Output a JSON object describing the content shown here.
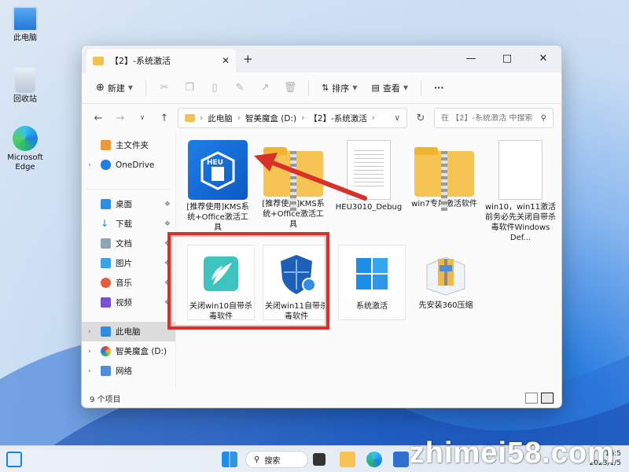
{
  "desktop": {
    "icons": [
      {
        "label": "此电脑"
      },
      {
        "label": "回收站"
      },
      {
        "label": "Microsoft Edge"
      }
    ]
  },
  "window": {
    "tab_title": "【2】-系统激活",
    "tab_close": "✕",
    "new_tab": "+",
    "toolbar": {
      "new_label": "新建",
      "sort_label": "排序",
      "view_label": "查看",
      "more_label": "···"
    },
    "address": {
      "crumbs": [
        "此电脑",
        "智美魔盒 (D:)",
        "【2】-系统激活"
      ],
      "search_placeholder": "在 【2】-系统激活 中搜索"
    },
    "sidebar": {
      "items": [
        {
          "label": "主文件夹"
        },
        {
          "label": "OneDrive"
        },
        {
          "label": "桌面"
        },
        {
          "label": "下载"
        },
        {
          "label": "文档"
        },
        {
          "label": "图片"
        },
        {
          "label": "音乐"
        },
        {
          "label": "视频"
        },
        {
          "label": "此电脑"
        },
        {
          "label": "智美魔盒 (D:)"
        },
        {
          "label": "网络"
        }
      ]
    },
    "files": [
      {
        "name": "[推荐使用]KMS系统+Office激活工具"
      },
      {
        "name": "[推荐使用]KMS系统+Office激活工具"
      },
      {
        "name": "HEU3010_Debug"
      },
      {
        "name": "win7专用激活软件"
      },
      {
        "name": "win10，win11激活前务必先关闭自带杀毒软件Windows Def..."
      },
      {
        "name": "关闭win10自带杀毒软件"
      },
      {
        "name": "关闭win11自带杀毒软件"
      },
      {
        "name": "系统激活"
      },
      {
        "name": "先安装360压缩"
      }
    ],
    "status": {
      "count": "9 个项目"
    }
  },
  "taskbar": {
    "search_label": "搜索",
    "time": "16:5",
    "date": "2023/1/5"
  },
  "watermark": "zhimei58.com",
  "colors": {
    "accent": "#0d59c5",
    "highlight_red": "#d9312a",
    "folder_yellow": "#f5c452"
  }
}
